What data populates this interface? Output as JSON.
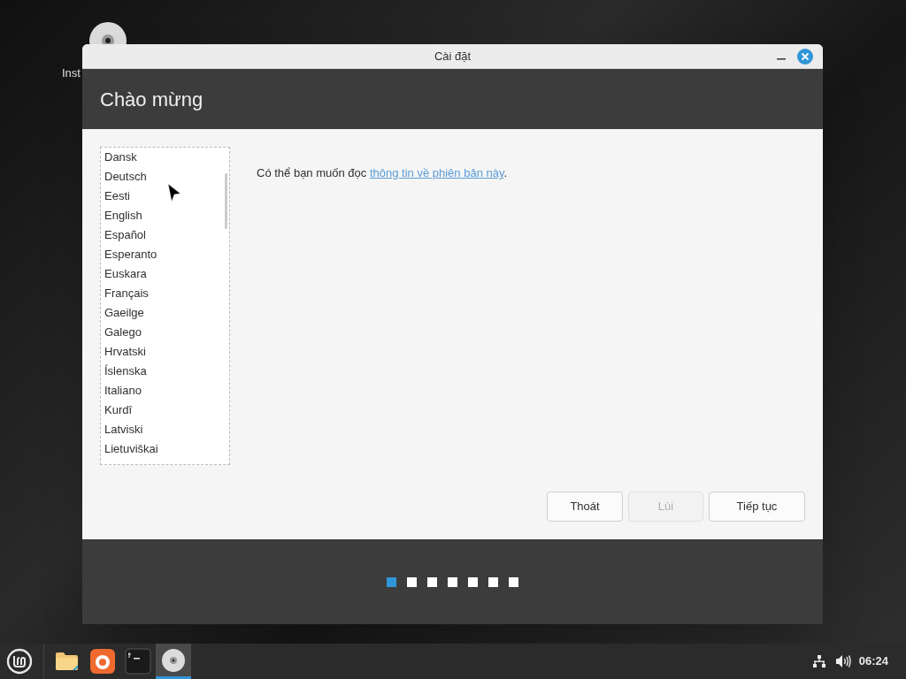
{
  "desktop": {
    "icon_label": "Inst"
  },
  "window": {
    "title": "Cài đặt",
    "heading": "Chào mừng"
  },
  "languages": [
    {
      "label": "Dansk",
      "selected": false
    },
    {
      "label": "Deutsch",
      "selected": false
    },
    {
      "label": "Eesti",
      "selected": false
    },
    {
      "label": "English",
      "selected": false
    },
    {
      "label": "Español",
      "selected": false
    },
    {
      "label": "Esperanto",
      "selected": false
    },
    {
      "label": "Euskara",
      "selected": false
    },
    {
      "label": "Français",
      "selected": false
    },
    {
      "label": "Gaeilge",
      "selected": false
    },
    {
      "label": "Galego",
      "selected": false
    },
    {
      "label": "Hrvatski",
      "selected": false
    },
    {
      "label": "Íslenska",
      "selected": false
    },
    {
      "label": "Italiano",
      "selected": false
    },
    {
      "label": "Kurdî",
      "selected": false
    },
    {
      "label": "Latviski",
      "selected": false
    },
    {
      "label": "Lietuviškai",
      "selected": false
    }
  ],
  "message": {
    "text": "Có thể bạn muốn đọc ",
    "link": "thông tin về phiên bản này",
    "after": "."
  },
  "buttons": [
    {
      "label": "Thoát",
      "disabled": false
    },
    {
      "label": "Lùi",
      "disabled": true
    },
    {
      "label": "Tiếp tục",
      "disabled": false
    }
  ],
  "steps": [
    {
      "selected": true
    },
    {
      "selected": false
    },
    {
      "selected": false
    },
    {
      "selected": false
    },
    {
      "selected": false
    },
    {
      "selected": false
    },
    {
      "selected": false
    }
  ],
  "taskbar": {
    "apps": [
      {
        "kind": "folder",
        "selected": false
      },
      {
        "kind": "browser",
        "selected": false
      },
      {
        "kind": "terminal",
        "selected": false
      },
      {
        "kind": "disc",
        "selected": true
      }
    ],
    "clock": "06:24"
  }
}
